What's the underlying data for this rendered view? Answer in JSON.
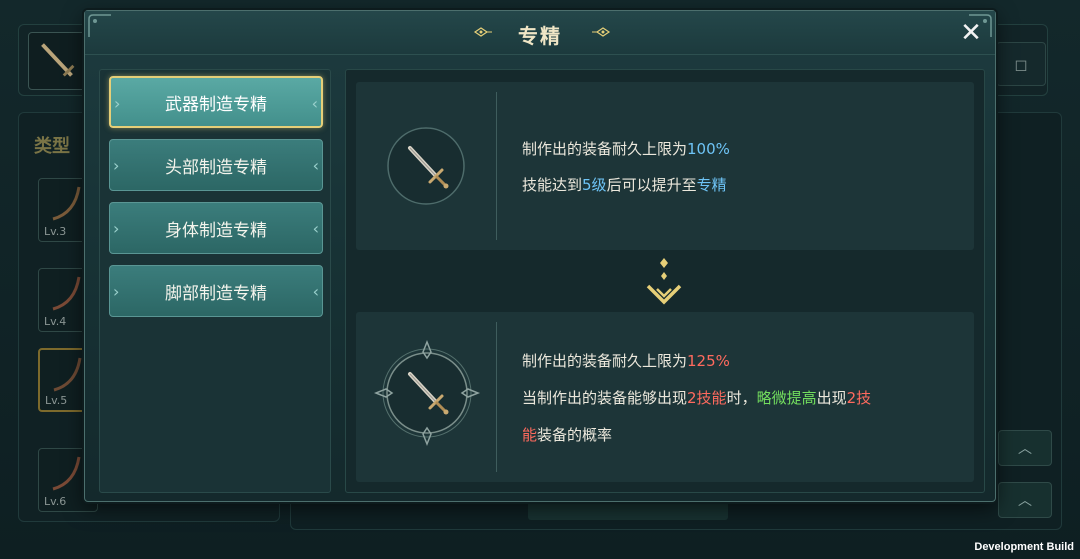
{
  "background": {
    "type_label": "类型",
    "slots": [
      {
        "level": "Lv.3"
      },
      {
        "level": "Lv.4"
      },
      {
        "level": "Lv.5"
      },
      {
        "level": "Lv.6"
      }
    ],
    "dev_build": "Development Build"
  },
  "modal": {
    "title": "专精",
    "close_symbol": "✕",
    "tabs": [
      {
        "label": "武器制造专精",
        "active": true
      },
      {
        "label": "头部制造专精",
        "active": false
      },
      {
        "label": "身体制造专精",
        "active": false
      },
      {
        "label": "脚部制造专精",
        "active": false
      }
    ],
    "current": {
      "line1_prefix": "制作出的装备耐久上限为",
      "line1_value": "100%",
      "line2_a": "技能达到",
      "line2_b": "5级",
      "line2_c": "后可以提升至",
      "line2_d": "专精"
    },
    "upgraded": {
      "line1_prefix": "制作出的装备耐久上限为",
      "line1_value": "125%",
      "line2_a": "当制作出的装备能够出现",
      "line2_b": "2技能",
      "line2_c": "时，",
      "line2_d": "略微提高",
      "line2_e": "出现",
      "line2_f": "2技",
      "line3_a": "能",
      "line3_b": "装备的概率"
    }
  },
  "colors": {
    "highlight_blue": "#6ec4f6",
    "highlight_red": "#ff6a5e",
    "highlight_green": "#73de5e",
    "accent_gold": "#e6cf78"
  }
}
